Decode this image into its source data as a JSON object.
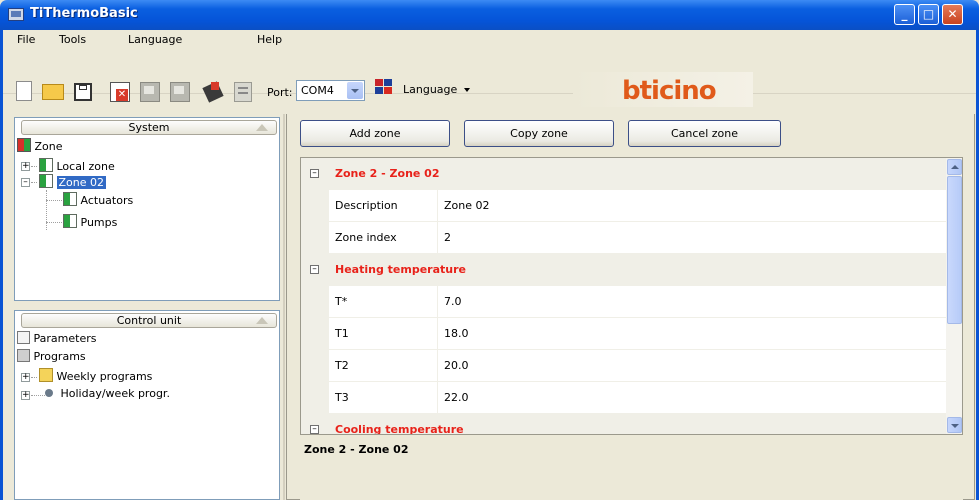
{
  "window": {
    "title": "TiThermoBasic"
  },
  "menu": {
    "items": [
      "File",
      "Tools",
      "Language",
      "Help"
    ]
  },
  "toolbar": {
    "port_label": "Port:",
    "port_value": "COM4",
    "language_label": "Language",
    "logo_text": "bticino",
    "icons": [
      "new-icon",
      "open-icon",
      "save-icon",
      "delete-icon",
      "flag-icon",
      "flag-icon",
      "download-icon",
      "document-icon"
    ]
  },
  "system_panel": {
    "header": "System",
    "root": "Zone",
    "items": [
      "Local zone",
      "Zone 02"
    ],
    "children": [
      "Actuators",
      "Pumps"
    ]
  },
  "control_panel": {
    "header": "Control unit",
    "items": [
      "Parameters",
      "Programs",
      "Weekly programs",
      "Holiday/week progr."
    ]
  },
  "actions": {
    "add": "Add zone",
    "copy": "Copy zone",
    "cancel": "Cancel zone"
  },
  "grid": {
    "category_1": "Zone 2 - Zone 02",
    "description_label": "Description",
    "description_value": "Zone 02",
    "index_label": "Zone index",
    "index_value": "2",
    "category_2": "Heating temperature",
    "tstar_label": "T*",
    "tstar_value": "7.0",
    "t1_label": "T1",
    "t1_value": "18.0",
    "t2_label": "T2",
    "t2_value": "20.0",
    "t3_label": "T3",
    "t3_value": "22.0",
    "category_3": "Cooling temperature"
  },
  "description_panel": {
    "title": "Zone 2 - Zone 02"
  },
  "colors": {
    "title_bar": "#0554d8",
    "category_text": "#e8221a",
    "logo": "#e05a1a"
  }
}
